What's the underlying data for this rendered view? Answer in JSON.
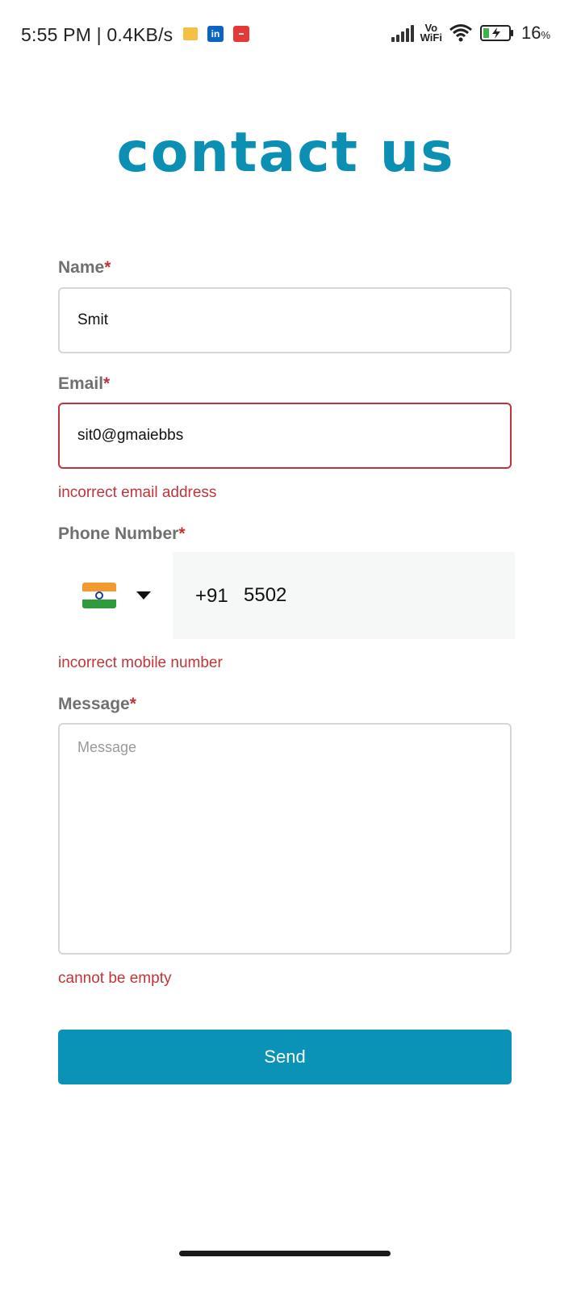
{
  "status_bar": {
    "time": "5:55 PM | 0.4KB/s",
    "network_label_top": "Vo",
    "network_label_bottom": "WiFi",
    "battery_percent": "16",
    "battery_unit": "%",
    "notification_icons": [
      "message-icon",
      "linkedin-icon",
      "news-icon"
    ]
  },
  "page": {
    "title": "contact us",
    "accent_color": "#0b8fb3",
    "error_color": "#c0343a"
  },
  "form": {
    "name": {
      "label": "Name",
      "required_mark": "*",
      "value": "Smit"
    },
    "email": {
      "label": "Email",
      "required_mark": "*",
      "value": "sit0@gmaiebbs",
      "error": "incorrect email address"
    },
    "phone": {
      "label": "Phone Number",
      "required_mark": "*",
      "country_flag": "india-flag-icon",
      "dial_code": "+91",
      "value": "5502",
      "error": "incorrect mobile number"
    },
    "message": {
      "label": "Message",
      "required_mark": "*",
      "value": "",
      "placeholder": "Message",
      "error": "cannot be empty"
    },
    "submit_label": "Send"
  }
}
